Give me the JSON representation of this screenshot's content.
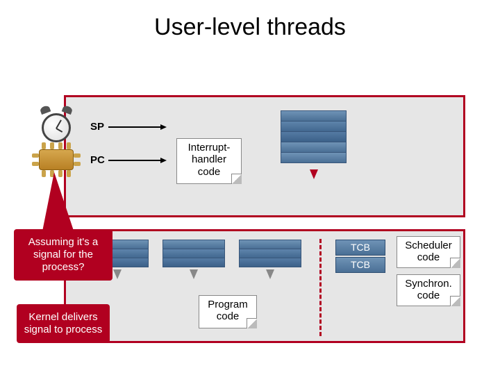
{
  "title": "User-level threads",
  "registers": {
    "sp": "SP",
    "pc": "PC"
  },
  "top_box": {
    "interrupt_handler": "Interrupt-\nhandler\ncode"
  },
  "bottom_box": {
    "program_code": "Program\ncode",
    "scheduler": "Scheduler\ncode",
    "synchron": "Synchron.\ncode",
    "tcb": "TCB"
  },
  "callouts": {
    "assuming": "Assuming it's a signal for the process?",
    "kernel": "Kernel delivers signal to process"
  }
}
